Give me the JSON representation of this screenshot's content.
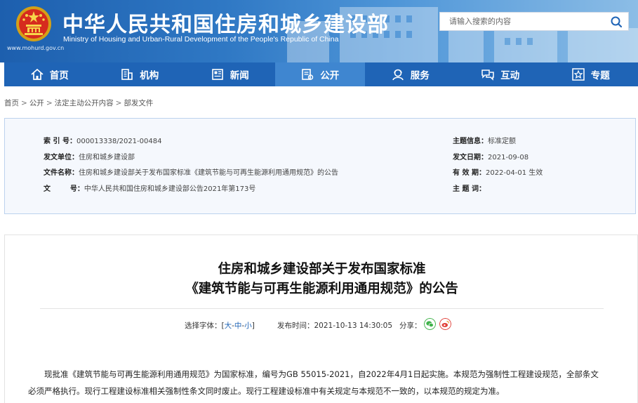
{
  "header": {
    "title_cn": "中华人民共和国住房和城乡建设部",
    "title_en": "Ministry of Housing and Urban-Rural Development of the People's Republic of China",
    "site_url": "www.mohurd.gov.cn",
    "search_placeholder": "请输入搜索的内容",
    "emblem_icon": "national-emblem-icon",
    "search_icon": "search-icon"
  },
  "nav": {
    "items": [
      {
        "label": "首页",
        "icon": "home-icon"
      },
      {
        "label": "机构",
        "icon": "building-icon"
      },
      {
        "label": "新闻",
        "icon": "newspaper-icon"
      },
      {
        "label": "公开",
        "icon": "document-icon"
      },
      {
        "label": "服务",
        "icon": "service-person-icon"
      },
      {
        "label": "互动",
        "icon": "chat-icon"
      },
      {
        "label": "专题",
        "icon": "star-icon"
      }
    ],
    "active_index": 3
  },
  "breadcrumb": [
    "首页",
    "公开",
    "法定主动公开内容",
    "部发文件"
  ],
  "breadcrumb_separator": ">",
  "info": {
    "index_label": "索 引 号：",
    "index_value": "000013338/2021-00484",
    "issuer_label": "发文单位：",
    "issuer_value": "住房和城乡建设部",
    "docname_label": "文件名称：",
    "docname_value": "住房和城乡建设部关于发布国家标准《建筑节能与可再生能源利用通用规范》的公告",
    "docno_label": "文        号：",
    "docno_value": "中华人民共和国住房和城乡建设部公告2021年第173号",
    "topic_label": "主题信息：",
    "topic_value": "标准定额",
    "date_label": "发文日期：",
    "date_value": "2021-09-08",
    "validity_label": "有 效 期：",
    "validity_value": "2022-04-01 生效",
    "keywords_label": "主 题 词："
  },
  "article": {
    "title_line1": "住房和城乡建设部关于发布国家标准",
    "title_line2": "《建筑节能与可再生能源利用通用规范》的公告",
    "font_size_label": "选择字体：[",
    "size_large": "大",
    "size_medium": "中",
    "size_small": "小",
    "size_sep": "-",
    "size_close": "]",
    "publish_label": "发布时间：",
    "publish_time": "2021-10-13 14:30:05",
    "share_label": "分享：",
    "body": "现批准《建筑节能与可再生能源利用通用规范》为国家标准，编号为GB 55015-2021，自2022年4月1日起实施。本规范为强制性工程建设规范，全部条文必须严格执行。现行工程建设标准相关强制性条文同时废止。现行工程建设标准中有关规定与本规范不一致的，以本规范的规定为准。"
  },
  "colors": {
    "nav_bg": "#1f64b6",
    "nav_active": "#3f86d0",
    "info_bg": "#f5f8fd",
    "info_border": "#bcd2ee",
    "wechat": "#3fb24a",
    "weibo": "#e0413a"
  }
}
